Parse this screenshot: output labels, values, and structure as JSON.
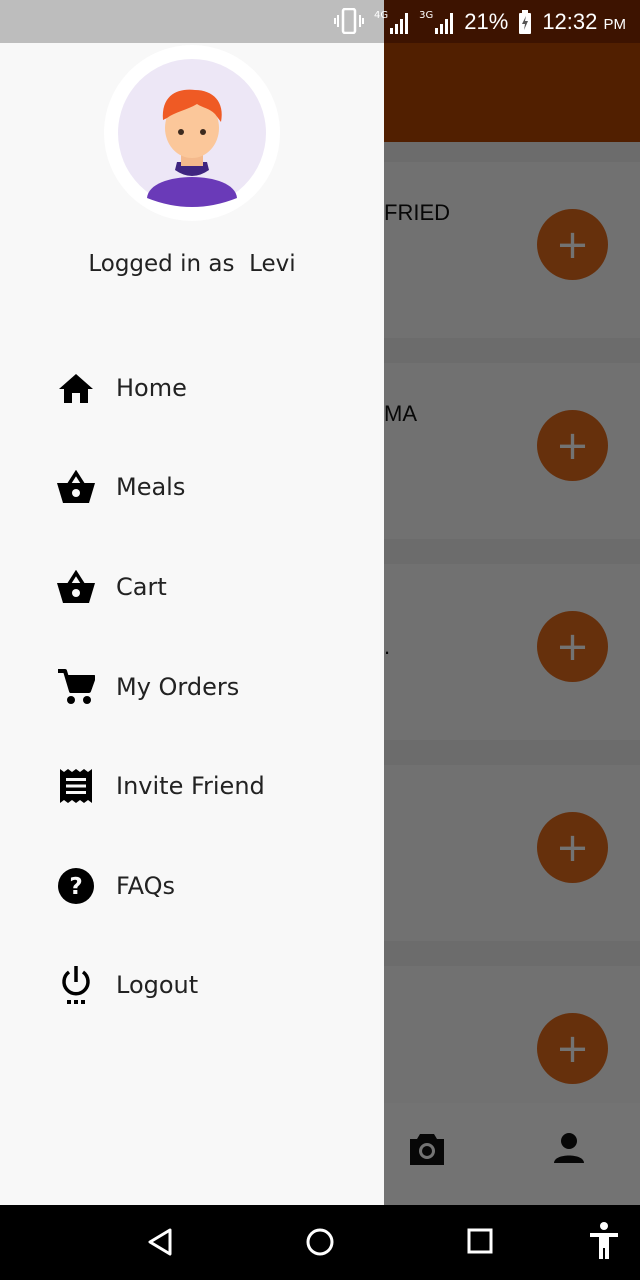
{
  "status_bar": {
    "net1": "4G",
    "net2": "3G",
    "battery": "21%",
    "time": "12:32",
    "ampm": "PM"
  },
  "background_app": {
    "cards": [
      {
        "title": "FRIED",
        "add_label": "+"
      },
      {
        "title": "MA",
        "add_label": "+"
      },
      {
        "title": ".",
        "add_label": "+"
      },
      {
        "title": "",
        "add_label": "+"
      },
      {
        "title": "",
        "add_label": "+"
      }
    ],
    "bottom_nav": [
      "camera-icon",
      "person-icon"
    ]
  },
  "drawer": {
    "logged_in_prefix": "Logged in as",
    "user_name": "Levi",
    "menu": [
      {
        "label": "Home",
        "icon": "home-icon"
      },
      {
        "label": "Meals",
        "icon": "basket-icon"
      },
      {
        "label": "Cart",
        "icon": "basket-icon"
      },
      {
        "label": "My Orders",
        "icon": "cart-icon"
      },
      {
        "label": "Invite Friend",
        "icon": "receipt-icon"
      },
      {
        "label": "FAQs",
        "icon": "help-icon"
      },
      {
        "label": "Logout",
        "icon": "power-icon"
      }
    ]
  },
  "colors": {
    "header": "#b34500",
    "fab": "#e36a1c",
    "drawer": "#f8f8f8",
    "avatar_bg": "#ede7f6"
  }
}
